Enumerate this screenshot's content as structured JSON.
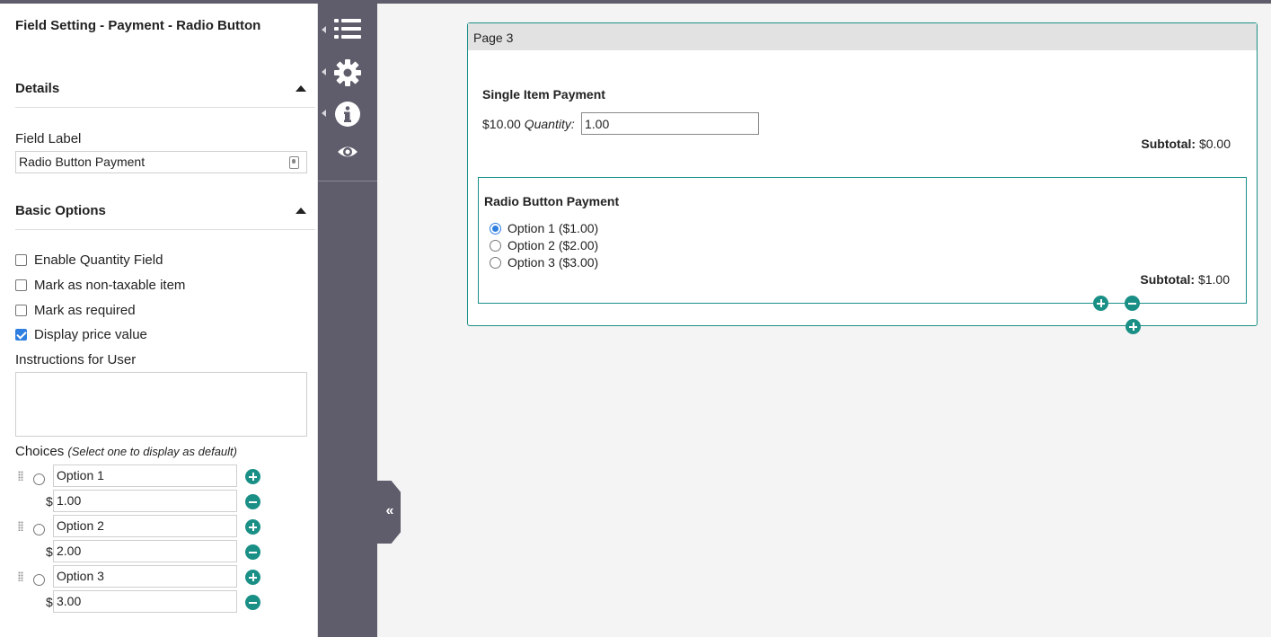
{
  "panel": {
    "title": "Field Setting - Payment - Radio Button",
    "details_heading": "Details",
    "field_label_caption": "Field Label",
    "field_label_value": "Radio Button Payment",
    "basic_options_heading": "Basic Options",
    "checkboxes": [
      {
        "label": "Enable Quantity Field",
        "checked": false
      },
      {
        "label": "Mark as non-taxable item",
        "checked": false
      },
      {
        "label": "Mark as required",
        "checked": false
      },
      {
        "label": "Display price value",
        "checked": true
      }
    ],
    "instructions_caption": "Instructions for User",
    "instructions_value": "",
    "choices_caption": "Choices",
    "choices_hint": "(Select one to display as default)",
    "currency_symbol": "$",
    "choices": [
      {
        "label": "Option 1",
        "price": "1.00"
      },
      {
        "label": "Option 2",
        "price": "2.00"
      },
      {
        "label": "Option 3",
        "price": "3.00"
      }
    ]
  },
  "strip": {
    "icons": [
      "list-icon",
      "gear-icon",
      "info-icon",
      "eye-icon"
    ],
    "collapse_glyph": "«"
  },
  "canvas": {
    "page_title": "Page 3",
    "single_item": {
      "title": "Single Item Payment",
      "price": "$10.00",
      "quantity_label": "Quantity:",
      "quantity_value": "1.00",
      "subtotal_label": "Subtotal:",
      "subtotal_value": "$0.00"
    },
    "radio_payment": {
      "title": "Radio Button Payment",
      "options": [
        "Option 1 ($1.00)",
        "Option 2 ($2.00)",
        "Option 3 ($3.00)"
      ],
      "selected_index": 0,
      "subtotal_label": "Subtotal:",
      "subtotal_value": "$1.00"
    }
  },
  "colors": {
    "accent": "#1a8f86",
    "sidebar": "#5f5d6b",
    "checkbox_checked": "#2f7fe0"
  }
}
